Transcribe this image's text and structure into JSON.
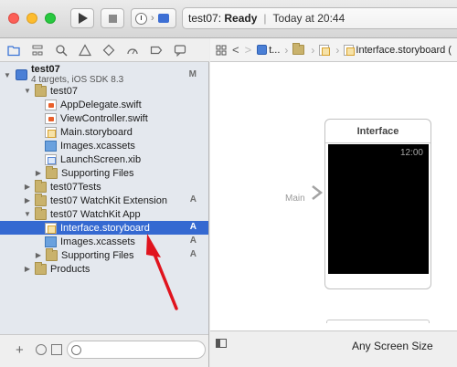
{
  "toolbar": {
    "status_project": "test07:",
    "status_state": "Ready",
    "status_divider": "|",
    "status_time": "Today at 20:44"
  },
  "navigator": {
    "project": {
      "name": "test07",
      "subtitle": "4 targets, iOS SDK 8.3",
      "badge": "M"
    },
    "rows": [
      {
        "label": "test07",
        "badge": ""
      },
      {
        "label": "AppDelegate.swift",
        "badge": ""
      },
      {
        "label": "ViewController.swift",
        "badge": ""
      },
      {
        "label": "Main.storyboard",
        "badge": ""
      },
      {
        "label": "Images.xcassets",
        "badge": ""
      },
      {
        "label": "LaunchScreen.xib",
        "badge": ""
      },
      {
        "label": "Supporting Files",
        "badge": ""
      },
      {
        "label": "test07Tests",
        "badge": ""
      },
      {
        "label": "test07 WatchKit Extension",
        "badge": "A"
      },
      {
        "label": "test07 WatchKit App",
        "badge": ""
      },
      {
        "label": "Interface.storyboard",
        "badge": "A"
      },
      {
        "label": "Images.xcassets",
        "badge": "A"
      },
      {
        "label": "Supporting Files",
        "badge": "A"
      },
      {
        "label": "Products",
        "badge": ""
      }
    ],
    "bottom_add": "+"
  },
  "editor": {
    "jump_bar": {
      "back": "<",
      "forward": ">",
      "crumb_project": "t...",
      "crumb_file": "Interface.storyboard ("
    },
    "entry_label": "Main",
    "scene_title": "Interface",
    "scene_clock": "12:00",
    "size_class": "Any Screen Size"
  },
  "colors": {
    "selection": "#3569d1",
    "annotation_arrow": "#e0141e"
  }
}
